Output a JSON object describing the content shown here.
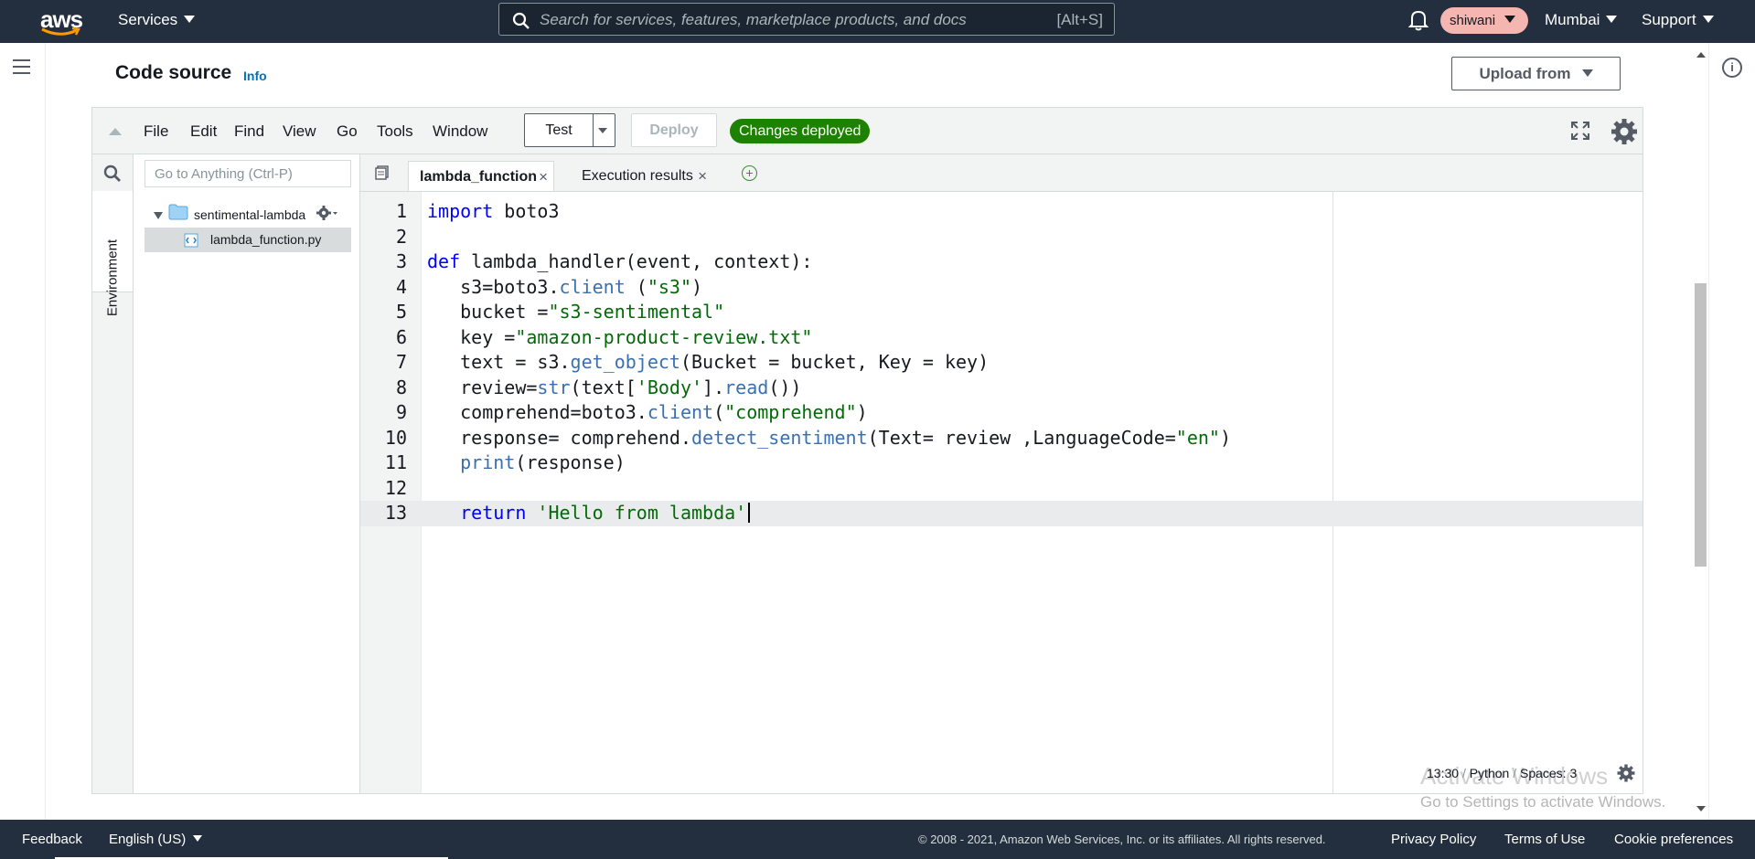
{
  "nav": {
    "logo_text": "aws",
    "services_label": "Services",
    "search_placeholder": "Search for services, features, marketplace products, and docs",
    "search_shortcut": "[Alt+S]",
    "user_label": "shiwani",
    "region_label": "Mumbai",
    "support_label": "Support"
  },
  "header": {
    "title": "Code source",
    "info_label": "Info",
    "upload_label": "Upload from"
  },
  "ide": {
    "menu": [
      "File",
      "Edit",
      "Find",
      "View",
      "Go",
      "Tools",
      "Window"
    ],
    "test_label": "Test",
    "deploy_label": "Deploy",
    "status_badge": "Changes deployed",
    "goto_placeholder": "Go to Anything (Ctrl-P)",
    "environment_label": "Environment",
    "folder_name": "sentimental-lambda",
    "file_name": "lambda_function.py",
    "tabs": [
      {
        "label": "lambda_function"
      },
      {
        "label": "Execution results"
      }
    ],
    "close_glyph": "×",
    "add_glyph": "+",
    "status_position": "13:30",
    "status_language": "Python",
    "status_spaces": "Spaces: 3"
  },
  "code_lines": [
    {
      "n": "1",
      "t": "import boto3"
    },
    {
      "n": "2",
      "t": ""
    },
    {
      "n": "3",
      "t": "def lambda_handler(event, context):"
    },
    {
      "n": "4",
      "t": "   s3=boto3.client (\"s3\")"
    },
    {
      "n": "5",
      "t": "   bucket =\"s3-sentimental\""
    },
    {
      "n": "6",
      "t": "   key =\"amazon-product-review.txt\""
    },
    {
      "n": "7",
      "t": "   text = s3.get_object(Bucket = bucket, Key = key)"
    },
    {
      "n": "8",
      "t": "   review=str(text['Body'].read())"
    },
    {
      "n": "9",
      "t": "   comprehend=boto3.client(\"comprehend\")"
    },
    {
      "n": "10",
      "t": "   response= comprehend.detect_sentiment(Text= review ,LanguageCode=\"en\")"
    },
    {
      "n": "11",
      "t": "   print(response)"
    },
    {
      "n": "12",
      "t": ""
    },
    {
      "n": "13",
      "t": "   return 'Hello from lambda'"
    }
  ],
  "overlay": {
    "watermark_title": "Activate Windows",
    "watermark_sub": "Go to Settings to activate Windows."
  },
  "footer": {
    "feedback": "Feedback",
    "language": "English (US)",
    "copyright": "© 2008 - 2021, Amazon Web Services, Inc. or its affiliates. All rights reserved.",
    "privacy": "Privacy Policy",
    "terms": "Terms of Use",
    "cookies": "Cookie preferences"
  },
  "colors": {
    "nav_bg": "#232f3e",
    "accent_orange": "#ff9900",
    "success_green": "#1d8102",
    "link_blue": "#0073bb"
  }
}
